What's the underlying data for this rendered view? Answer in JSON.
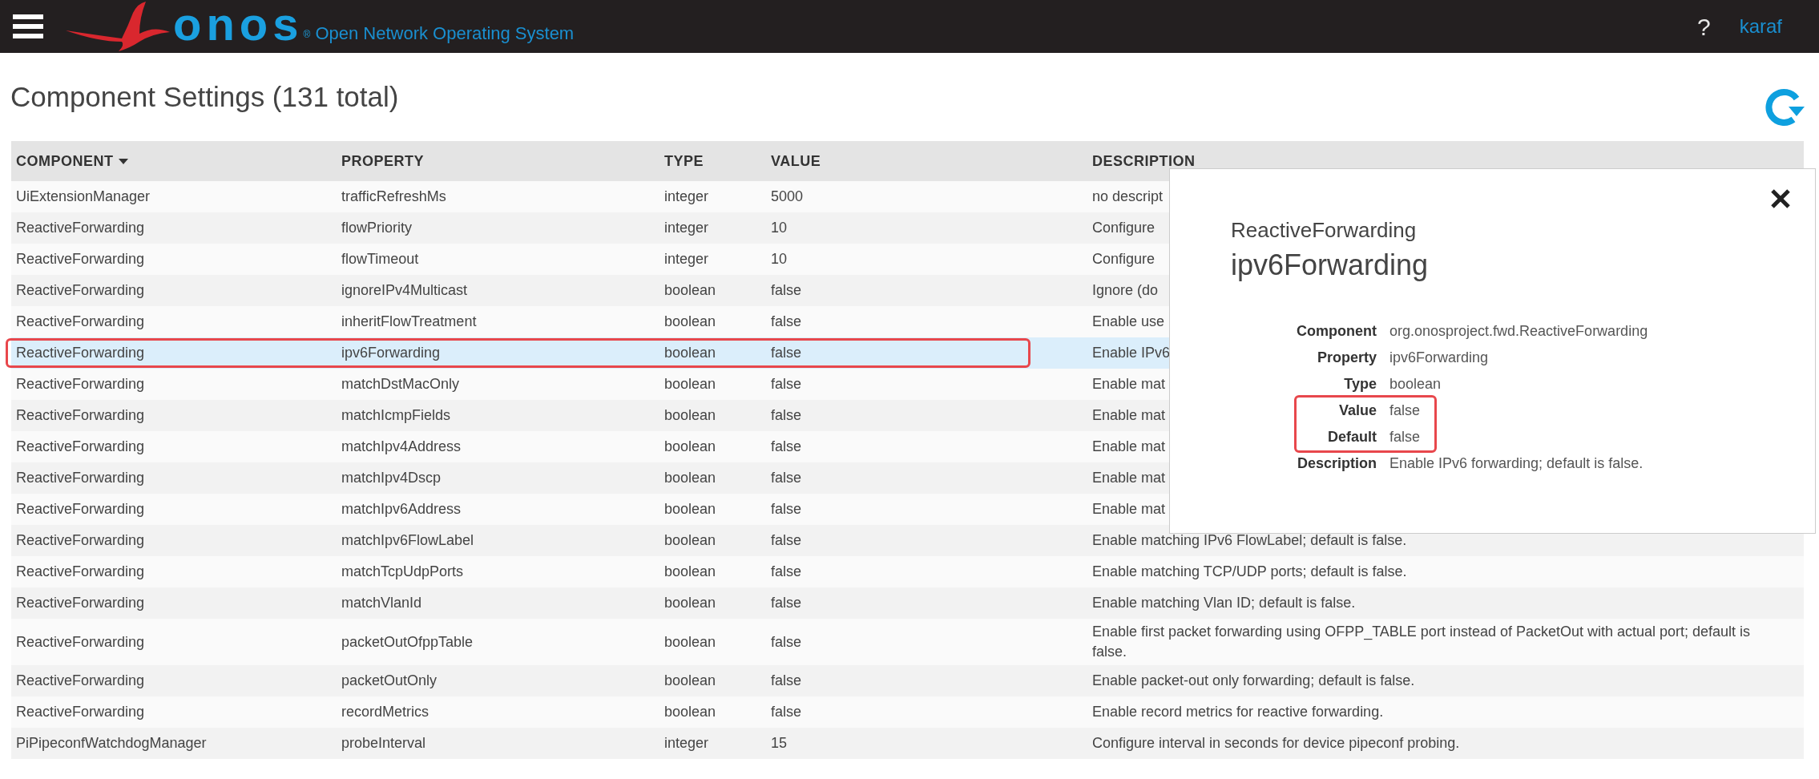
{
  "header": {
    "logo": "onos",
    "registered": "®",
    "tagline": "Open Network Operating System",
    "help": "?",
    "user": "karaf"
  },
  "page": {
    "title": "Component Settings (131 total)"
  },
  "table": {
    "columns": [
      {
        "label": "COMPONENT",
        "sorted": true
      },
      {
        "label": "PROPERTY",
        "sorted": false
      },
      {
        "label": "TYPE",
        "sorted": false
      },
      {
        "label": "VALUE",
        "sorted": false
      },
      {
        "label": "DESCRIPTION",
        "sorted": false
      }
    ],
    "rows": [
      {
        "component": "UiExtensionManager",
        "property": "trafficRefreshMs",
        "type": "integer",
        "value": "5000",
        "description": "no descript",
        "selected": false,
        "annotated": false
      },
      {
        "component": "ReactiveForwarding",
        "property": "flowPriority",
        "type": "integer",
        "value": "10",
        "description": "Configure",
        "selected": false,
        "annotated": false
      },
      {
        "component": "ReactiveForwarding",
        "property": "flowTimeout",
        "type": "integer",
        "value": "10",
        "description": "Configure",
        "selected": false,
        "annotated": false
      },
      {
        "component": "ReactiveForwarding",
        "property": "ignoreIPv4Multicast",
        "type": "boolean",
        "value": "false",
        "description": "Ignore (do",
        "selected": false,
        "annotated": false
      },
      {
        "component": "ReactiveForwarding",
        "property": "inheritFlowTreatment",
        "type": "boolean",
        "value": "false",
        "description": "Enable use",
        "selected": false,
        "annotated": false
      },
      {
        "component": "ReactiveForwarding",
        "property": "ipv6Forwarding",
        "type": "boolean",
        "value": "false",
        "description": "Enable IPv6",
        "selected": true,
        "annotated": true
      },
      {
        "component": "ReactiveForwarding",
        "property": "matchDstMacOnly",
        "type": "boolean",
        "value": "false",
        "description": "Enable mat",
        "selected": false,
        "annotated": false
      },
      {
        "component": "ReactiveForwarding",
        "property": "matchIcmpFields",
        "type": "boolean",
        "value": "false",
        "description": "Enable mat",
        "selected": false,
        "annotated": false
      },
      {
        "component": "ReactiveForwarding",
        "property": "matchIpv4Address",
        "type": "boolean",
        "value": "false",
        "description": "Enable mat",
        "selected": false,
        "annotated": false
      },
      {
        "component": "ReactiveForwarding",
        "property": "matchIpv4Dscp",
        "type": "boolean",
        "value": "false",
        "description": "Enable mat",
        "selected": false,
        "annotated": false
      },
      {
        "component": "ReactiveForwarding",
        "property": "matchIpv6Address",
        "type": "boolean",
        "value": "false",
        "description": "Enable mat",
        "selected": false,
        "annotated": false
      },
      {
        "component": "ReactiveForwarding",
        "property": "matchIpv6FlowLabel",
        "type": "boolean",
        "value": "false",
        "description": "Enable matching IPv6 FlowLabel; default is false.",
        "selected": false,
        "annotated": false
      },
      {
        "component": "ReactiveForwarding",
        "property": "matchTcpUdpPorts",
        "type": "boolean",
        "value": "false",
        "description": "Enable matching TCP/UDP ports; default is false.",
        "selected": false,
        "annotated": false
      },
      {
        "component": "ReactiveForwarding",
        "property": "matchVlanId",
        "type": "boolean",
        "value": "false",
        "description": "Enable matching Vlan ID; default is false.",
        "selected": false,
        "annotated": false
      },
      {
        "component": "ReactiveForwarding",
        "property": "packetOutOfppTable",
        "type": "boolean",
        "value": "false",
        "description": "Enable first packet forwarding using OFPP_TABLE port instead of PacketOut with actual port; default is false.",
        "selected": false,
        "annotated": false
      },
      {
        "component": "ReactiveForwarding",
        "property": "packetOutOnly",
        "type": "boolean",
        "value": "false",
        "description": "Enable packet-out only forwarding; default is false.",
        "selected": false,
        "annotated": false
      },
      {
        "component": "ReactiveForwarding",
        "property": "recordMetrics",
        "type": "boolean",
        "value": "false",
        "description": "Enable record metrics for reactive forwarding.",
        "selected": false,
        "annotated": false
      },
      {
        "component": "PiPipeconfWatchdogManager",
        "property": "probeInterval",
        "type": "integer",
        "value": "15",
        "description": "Configure interval in seconds for device pipeconf probing.",
        "selected": false,
        "annotated": false
      }
    ]
  },
  "details": {
    "component_name": "ReactiveForwarding",
    "property_name": "ipv6Forwarding",
    "fields": [
      {
        "label": "Component",
        "value": "org.onosproject.fwd.ReactiveForwarding",
        "highlighted": false
      },
      {
        "label": "Property",
        "value": "ipv6Forwarding",
        "highlighted": false
      },
      {
        "label": "Type",
        "value": "boolean",
        "highlighted": false
      },
      {
        "label": "Value",
        "value": "false",
        "highlighted": true
      },
      {
        "label": "Default",
        "value": "false",
        "highlighted": true
      },
      {
        "label": "Description",
        "value": "Enable IPv6 forwarding; default is false.",
        "highlighted": false
      }
    ]
  }
}
